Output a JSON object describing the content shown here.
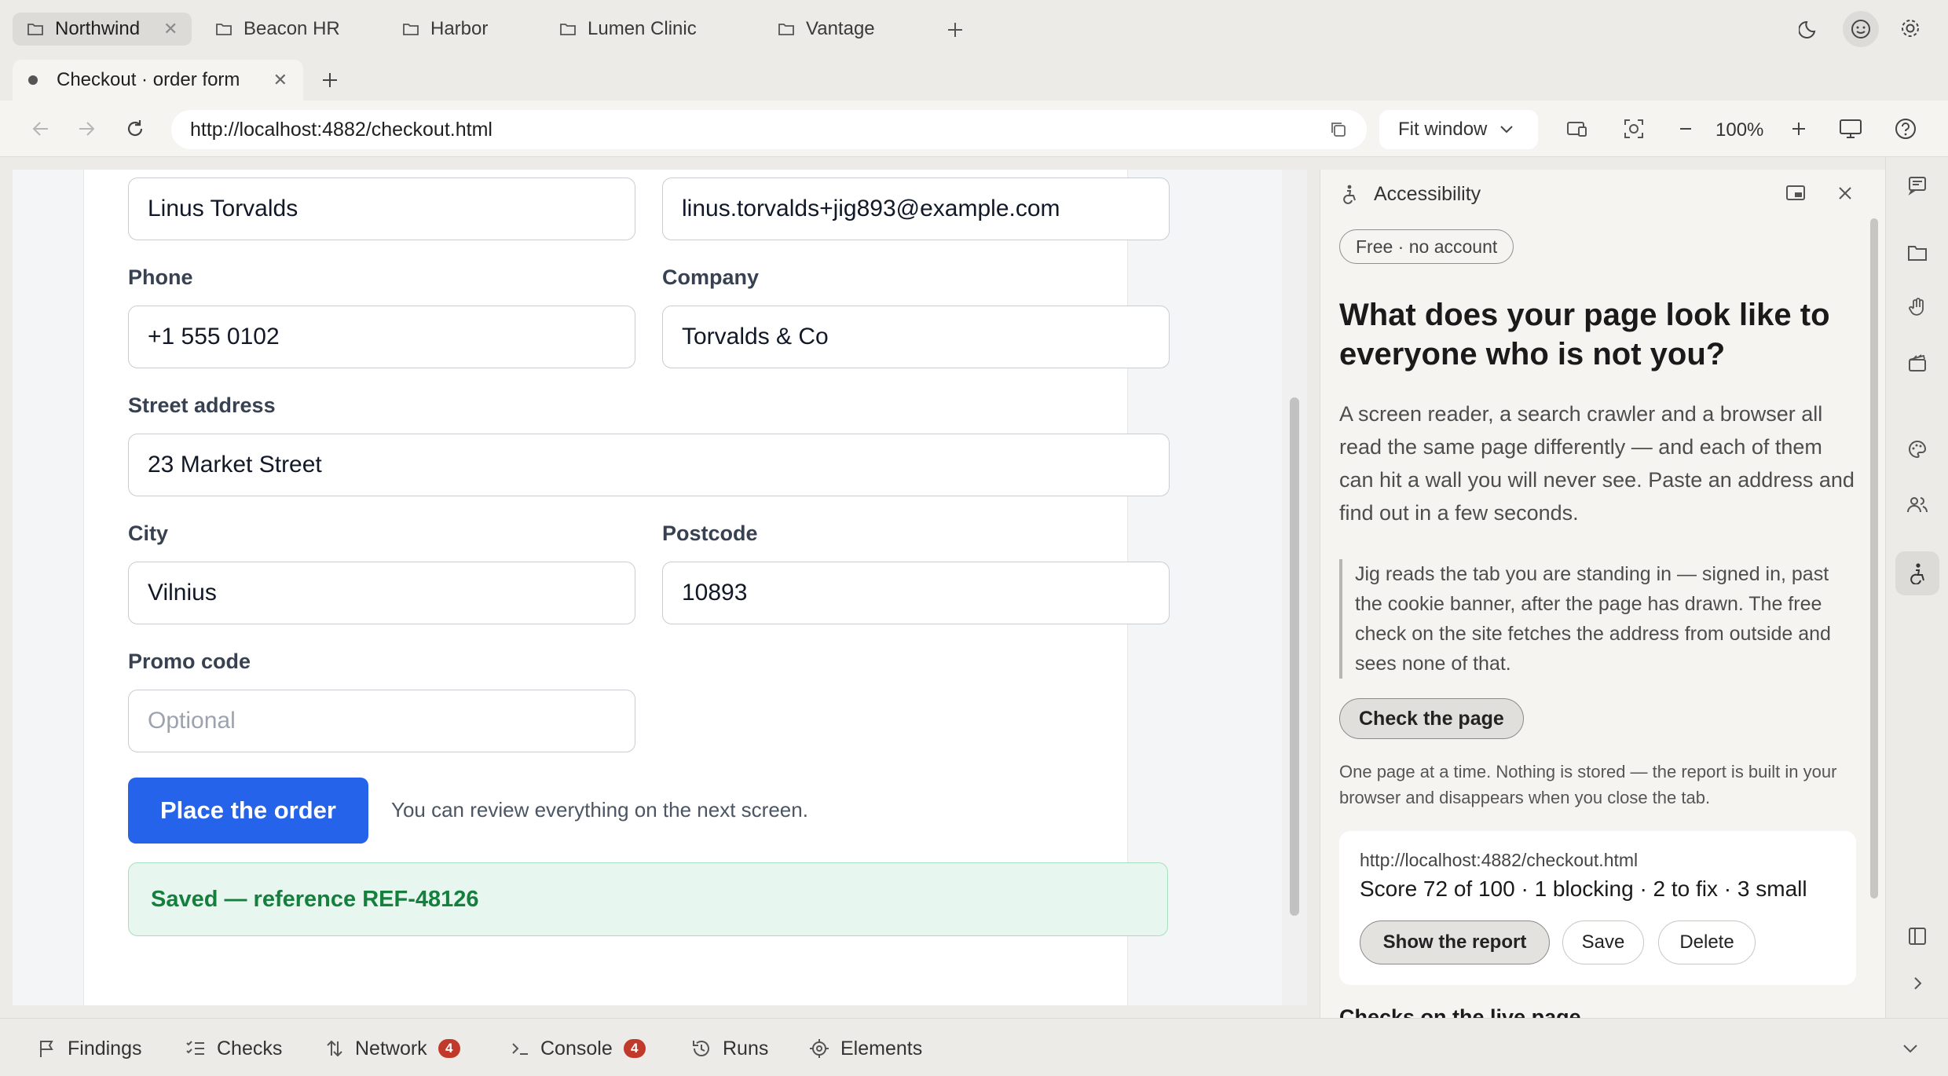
{
  "workspace_tabs": [
    {
      "label": "Northwind",
      "active": true
    },
    {
      "label": "Beacon HR"
    },
    {
      "label": "Harbor"
    },
    {
      "label": "Lumen Clinic"
    },
    {
      "label": "Vantage"
    }
  ],
  "page_tab": {
    "title": "Checkout · order form"
  },
  "toolbar": {
    "url": "http://localhost:4882/checkout.html",
    "fit_mode": "Fit window",
    "zoom": "100%"
  },
  "form": {
    "name_value": "Linus Torvalds",
    "email_value": "linus.torvalds+jig893@example.com",
    "phone_label": "Phone",
    "phone_value": "+1 555 0102",
    "company_label": "Company",
    "company_value": "Torvalds & Co",
    "street_label": "Street address",
    "street_value": "23 Market Street",
    "city_label": "City",
    "city_value": "Vilnius",
    "postcode_label": "Postcode",
    "postcode_value": "10893",
    "promo_label": "Promo code",
    "promo_placeholder": "Optional",
    "submit_label": "Place the order",
    "review_note": "You can review everything on the next screen.",
    "saved_message": "Saved — reference REF-48126",
    "accent_color": "#2563eb",
    "success_color": "#15803d"
  },
  "panel": {
    "title": "Accessibility",
    "pill": "Free · no account",
    "heading": "What does your page look like to everyone who is not you?",
    "intro": "A screen reader, a search crawler and a browser all read the same page differently — and each of them can hit a wall you will never see. Paste an address and find out in a few seconds.",
    "quote": "Jig reads the tab you are standing in — signed in, past the cookie banner, after the page has drawn. The free check on the site fetches the address from outside and sees none of that.",
    "check_button": "Check the page",
    "note": "One page at a time. Nothing is stored — the report is built in your browser and disappears when you close the tab.",
    "report": {
      "url": "http://localhost:4882/checkout.html",
      "summary": "Score 72 of 100 · 1 blocking · 2 to fix · 3 small",
      "show_label": "Show the report",
      "save_label": "Save",
      "delete_label": "Delete"
    },
    "checks_heading": "Checks on the live page"
  },
  "bottom_tabs": [
    {
      "label": "Findings",
      "icon": "flag-icon"
    },
    {
      "label": "Checks",
      "icon": "checklist-icon"
    },
    {
      "label": "Network",
      "icon": "arrows-icon",
      "badge": "4"
    },
    {
      "label": "Console",
      "icon": "terminal-icon",
      "badge": "4"
    },
    {
      "label": "Runs",
      "icon": "history-icon"
    },
    {
      "label": "Elements",
      "icon": "target-icon"
    }
  ]
}
